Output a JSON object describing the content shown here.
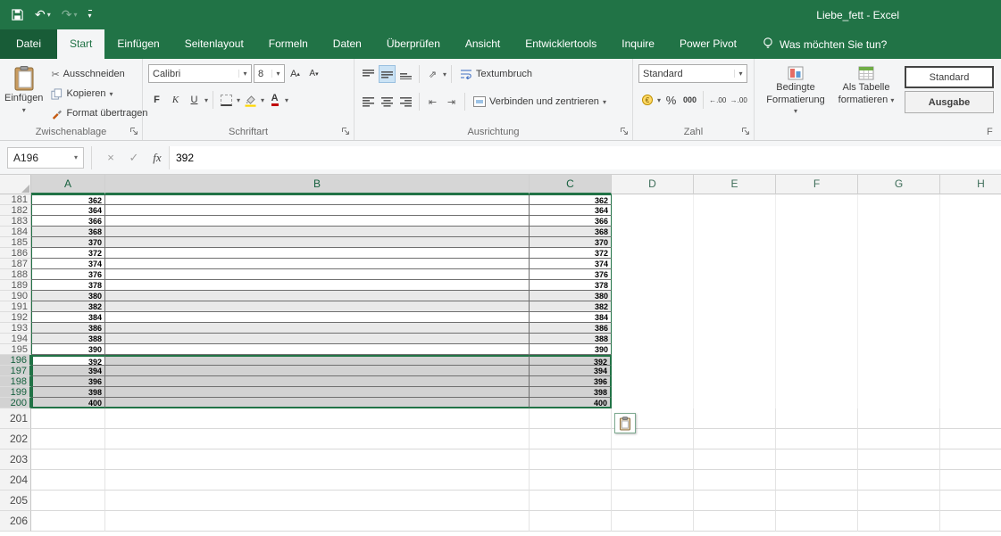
{
  "window": {
    "title": "Liebe_fett  -  Excel"
  },
  "menu": {
    "tabs": [
      {
        "label": "Datei",
        "type": "file"
      },
      {
        "label": "Start",
        "active": true
      },
      {
        "label": "Einfügen"
      },
      {
        "label": "Seitenlayout"
      },
      {
        "label": "Formeln"
      },
      {
        "label": "Daten"
      },
      {
        "label": "Überprüfen"
      },
      {
        "label": "Ansicht"
      },
      {
        "label": "Entwicklertools"
      },
      {
        "label": "Inquire"
      },
      {
        "label": "Power Pivot"
      }
    ],
    "tell_me": "Was möchten Sie tun?"
  },
  "ribbon": {
    "clipboard": {
      "group": "Zwischenablage",
      "paste": "Einfügen",
      "cut": "Ausschneiden",
      "copy": "Kopieren",
      "format_painter": "Format übertragen"
    },
    "font": {
      "group": "Schriftart",
      "family": "Calibri",
      "size": "8",
      "bold": "F",
      "italic": "K",
      "underline": "U"
    },
    "alignment": {
      "group": "Ausrichtung",
      "wrap_text": "Textumbruch",
      "merge_center": "Verbinden und zentrieren"
    },
    "number": {
      "group": "Zahl",
      "format": "Standard",
      "percent": "%",
      "thousand": "000",
      "add_decimal": "←.00",
      "remove_decimal": "→.00"
    },
    "styles": {
      "group_partial": "F",
      "conditional": [
        "Bedingte",
        "Formatierung"
      ],
      "format_table": [
        "Als Tabelle",
        "formatieren"
      ],
      "cell_styles": [
        {
          "label": "Standard",
          "selected": true
        },
        {
          "label": "Ausgabe",
          "bold": true
        }
      ]
    }
  },
  "formula_bar": {
    "name_box": "A196",
    "value": "392"
  },
  "sheet": {
    "columns": [
      "A",
      "B",
      "C",
      "D",
      "E",
      "F",
      "G",
      "H"
    ],
    "selected_columns": [
      "A",
      "B",
      "C"
    ],
    "rows": [
      {
        "n": 181,
        "v": 362
      },
      {
        "n": 182,
        "v": 364
      },
      {
        "n": 183,
        "v": 366
      },
      {
        "n": 184,
        "v": 368
      },
      {
        "n": 185,
        "v": 370
      },
      {
        "n": 186,
        "v": 372
      },
      {
        "n": 187,
        "v": 374
      },
      {
        "n": 188,
        "v": 376
      },
      {
        "n": 189,
        "v": 378
      },
      {
        "n": 190,
        "v": 380
      },
      {
        "n": 191,
        "v": 382
      },
      {
        "n": 192,
        "v": 384
      },
      {
        "n": 193,
        "v": 386
      },
      {
        "n": 194,
        "v": 388
      },
      {
        "n": 195,
        "v": 390
      },
      {
        "n": 196,
        "v": 392
      },
      {
        "n": 197,
        "v": 394
      },
      {
        "n": 198,
        "v": 396
      },
      {
        "n": 199,
        "v": 398
      },
      {
        "n": 200,
        "v": 400
      }
    ],
    "banded_rows": [
      184,
      185,
      190,
      191,
      193,
      194
    ],
    "selected_rows": [
      196,
      197,
      198,
      199,
      200
    ],
    "active_cell": "A196",
    "empty_rows": [
      201,
      202,
      203,
      204,
      205,
      206
    ]
  },
  "colors": {
    "excel_green": "#217346",
    "selection_fill": "#d2d2d2",
    "band_fill": "#e9e9e9"
  }
}
